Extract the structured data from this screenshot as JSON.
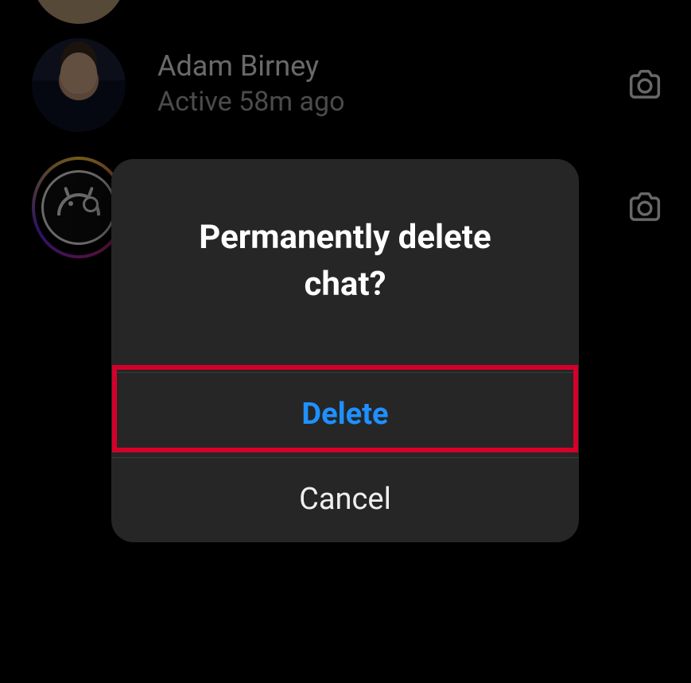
{
  "chats": [
    {
      "name": "",
      "status": ""
    },
    {
      "name": "Adam Birney",
      "status": "Active 58m ago"
    },
    {
      "name": "",
      "status": ""
    }
  ],
  "icons": {
    "camera": "camera-icon",
    "android": "android-icon"
  },
  "modal": {
    "title": "Permanently delete chat?",
    "delete_label": "Delete",
    "cancel_label": "Cancel"
  },
  "colors": {
    "modal_bg": "#262626",
    "accent_blue": "#1e90ff",
    "highlight_red": "#d4002a",
    "story_ring": [
      "#f9ce34",
      "#ee2a7b",
      "#6228d7"
    ]
  }
}
